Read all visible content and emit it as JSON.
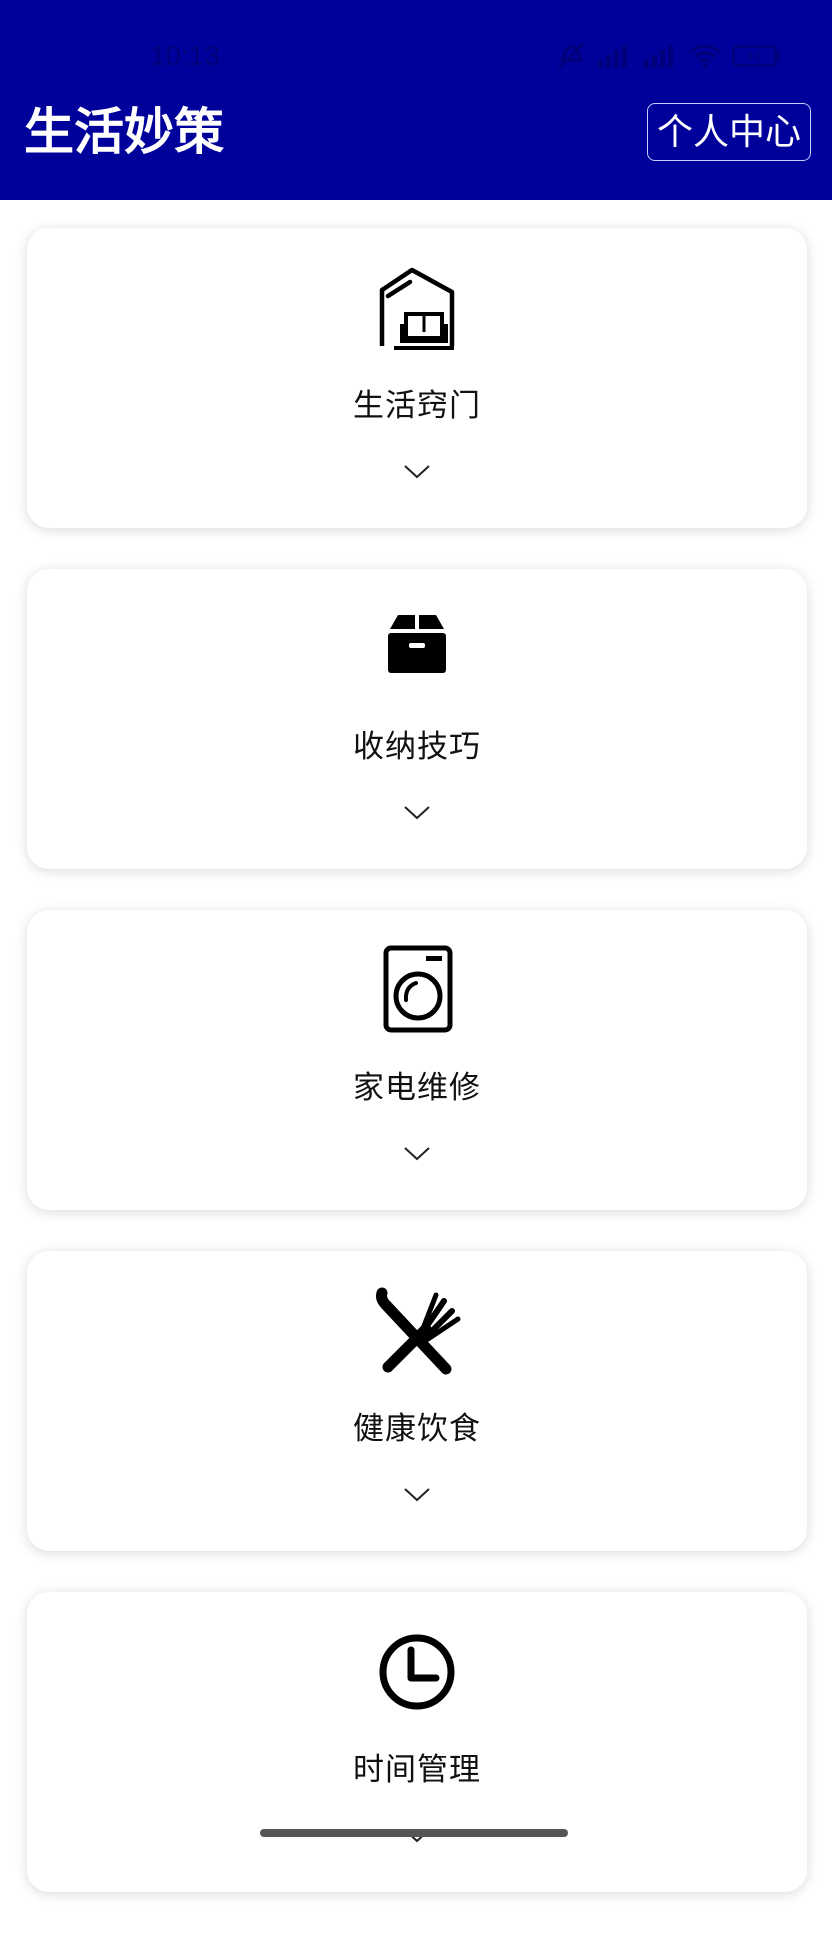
{
  "status_bar": {
    "time": "10:13",
    "battery": "43"
  },
  "header": {
    "title": "生活妙策",
    "profile_button": "个人中心"
  },
  "cards": [
    {
      "label": "生活窍门",
      "icon": "house-sofa-icon"
    },
    {
      "label": "收纳技巧",
      "icon": "storage-box-icon"
    },
    {
      "label": "家电维修",
      "icon": "washing-machine-icon"
    },
    {
      "label": "健康饮食",
      "icon": "fork-knife-icon"
    },
    {
      "label": "时间管理",
      "icon": "clock-icon"
    }
  ],
  "colors": {
    "appbar": "#00009b",
    "background": "#ffffff"
  }
}
